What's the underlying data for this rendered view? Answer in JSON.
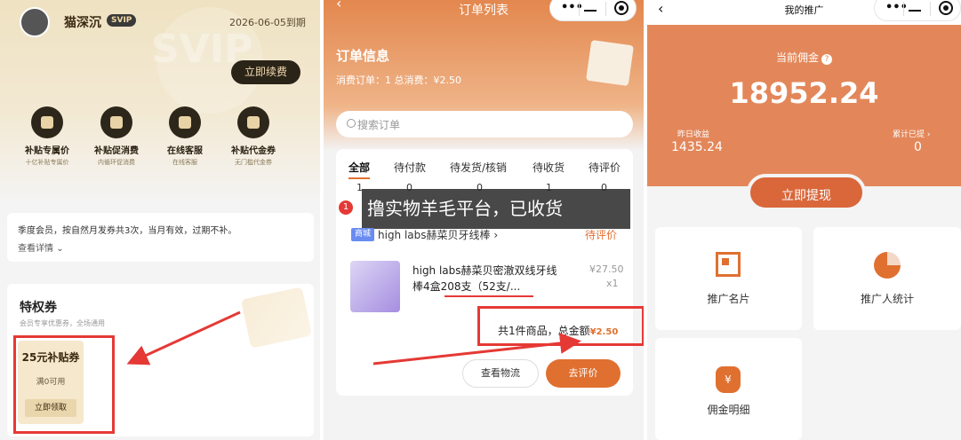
{
  "panel1": {
    "username": "猫深沉",
    "svip_badge": "SVIP",
    "svip_watermark": "SVIP",
    "expire_text": "2026-06-05到期",
    "renew_button": "立即续费",
    "benefits": [
      {
        "title": "补贴专属价",
        "sub": "十亿补贴专属价",
        "icon": "coupon-icon"
      },
      {
        "title": "补贴促消费",
        "sub": "内循环促消费",
        "icon": "gift-icon"
      },
      {
        "title": "在线客服",
        "sub": "在线客服",
        "icon": "headset-icon"
      },
      {
        "title": "补贴代金券",
        "sub": "无门槛代金券",
        "icon": "ticket-icon"
      }
    ],
    "note_text": "季度会员，按自然月发券共3次，当月有效，过期不补。",
    "note_more": "查看详情",
    "privilege_title": "特权券",
    "privilege_sub": "会员专享优惠券，全场通用",
    "coupon_title": "25元补贴券",
    "coupon_condition": "满0可用",
    "coupon_button": "立即领取"
  },
  "panel2": {
    "nav_title": "订单列表",
    "capsule_dots": "•••",
    "order_info_title": "订单信息",
    "order_info_sub": "消费订单：1 总消费：¥2.50",
    "search_placeholder": "搜索订单",
    "tabs": [
      {
        "label": "全部",
        "count": "1"
      },
      {
        "label": "待付款",
        "count": "0"
      },
      {
        "label": "待发货/核销",
        "count": "0"
      },
      {
        "label": "待收货",
        "count": "1"
      },
      {
        "label": "待评价",
        "count": "0"
      }
    ],
    "badge_count": "1",
    "overlay_text": "撸实物羊毛平台，已收货",
    "shop_tag": "商城",
    "shop_name": "high labs赫菜贝牙线棒 ›",
    "order_status": "待评价",
    "product_name": "high labs赫菜贝密澈双线牙线棒4盒208支（52支/...",
    "product_price": "¥27.50",
    "product_qty": "x1",
    "total_prefix": "共1件商品，总金额",
    "total_amount": "¥2.50",
    "btn_logistics": "查看物流",
    "btn_review": "去评价"
  },
  "panel3": {
    "nav_title": "我的推广",
    "commission_label": "当前佣金",
    "help_mark": "?",
    "commission_amount": "18952.24",
    "yesterday_label": "昨日收益",
    "yesterday_value": "1435.24",
    "withdrawn_label": "累计已提 ›",
    "withdrawn_value": "0",
    "withdraw_button": "立即提现",
    "tiles": [
      {
        "label": "推广名片",
        "icon": "qr-code-icon"
      },
      {
        "label": "推广人统计",
        "icon": "pie-chart-icon"
      },
      {
        "label": "佣金明细",
        "icon": "money-bag-icon",
        "icon_text": "¥"
      }
    ]
  },
  "colors": {
    "accent": "#e07030",
    "annotation_red": "#e53935",
    "vip_gold": "#efe2c2"
  }
}
